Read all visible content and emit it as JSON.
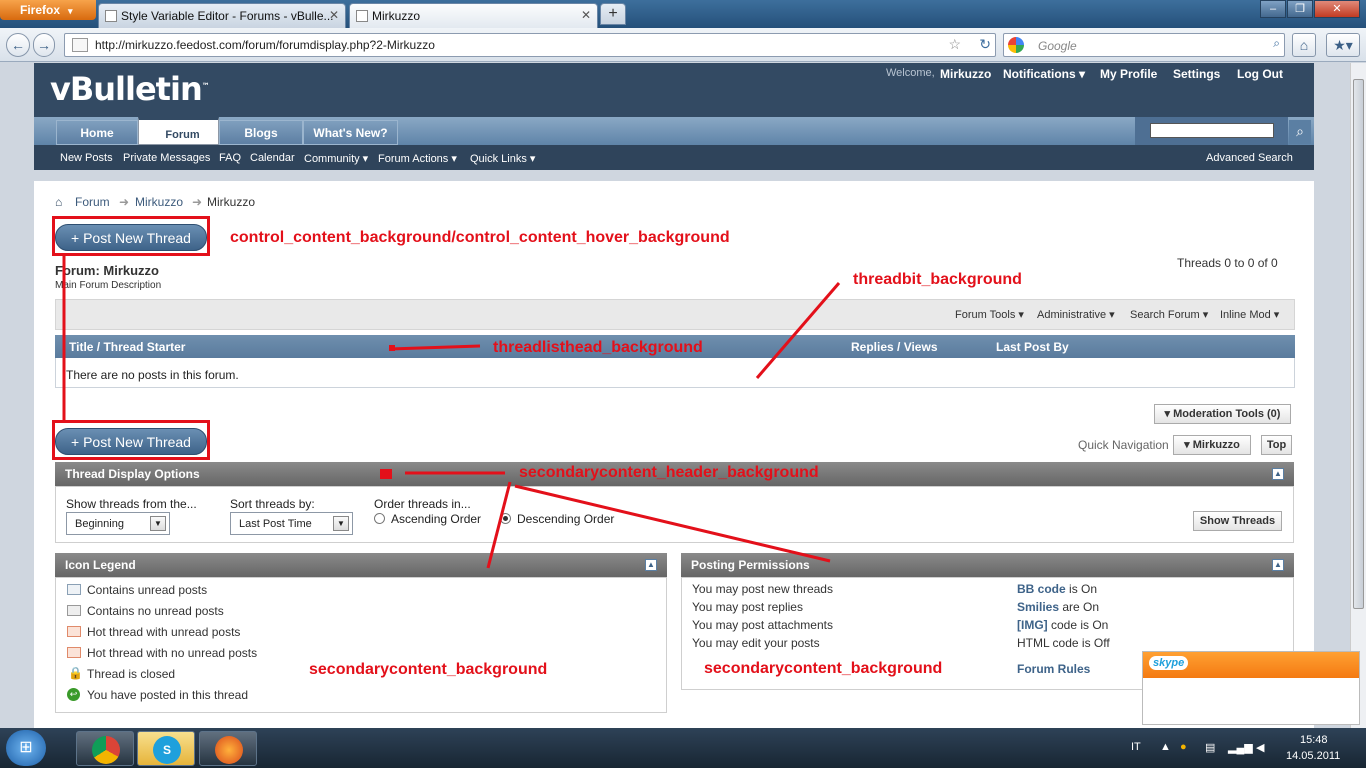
{
  "browser": {
    "app_button": "Firefox",
    "tabs": [
      {
        "label": "Style Variable Editor - Forums - vBulle..."
      },
      {
        "label": "Mirkuzzo"
      }
    ],
    "url": "http://mirkuzzo.feedost.com/forum/forumdisplay.php?2-Mirkuzzo",
    "search_placeholder": "Google"
  },
  "header": {
    "logo": "vBulletin",
    "welcome": "Welcome,",
    "username": "Mirkuzzo",
    "links": [
      "Notifications ▾",
      "My Profile",
      "Settings",
      "Log Out"
    ]
  },
  "nav": {
    "tabs": [
      "Home",
      "Forum",
      "Blogs",
      "What's New?"
    ],
    "subnav": [
      "New Posts",
      "Private Messages",
      "FAQ",
      "Calendar",
      "Community ▾",
      "Forum Actions ▾",
      "Quick Links ▾"
    ],
    "advanced_search": "Advanced Search"
  },
  "breadcrumb": [
    "Forum",
    "Mirkuzzo",
    "Mirkuzzo"
  ],
  "forum": {
    "post_button": "+ Post New Thread",
    "title": "Forum: Mirkuzzo",
    "description": "Main Forum Description",
    "threads_count": "Threads 0 to 0 of 0",
    "tools": [
      "Forum Tools ▾",
      "Administrative ▾",
      "Search Forum ▾",
      "Inline Mod ▾"
    ],
    "columns": {
      "title": "Title / Thread Starter",
      "replies": "Replies / Views",
      "last_post": "Last Post By"
    },
    "empty": "There are no posts in this forum.",
    "moderation": "▾ Moderation Tools (0)",
    "quick_nav_label": "Quick Navigation",
    "quick_nav_value": "▾ Mirkuzzo",
    "top": "Top"
  },
  "display_options": {
    "header": "Thread Display Options",
    "show_from_label": "Show threads from the...",
    "show_from_value": "Beginning",
    "sort_label": "Sort threads by:",
    "sort_value": "Last Post Time",
    "order_label": "Order threads in...",
    "asc": "Ascending Order",
    "desc": "Descending Order",
    "button": "Show Threads"
  },
  "legend": {
    "header": "Icon Legend",
    "items": [
      "Contains unread posts",
      "Contains no unread posts",
      "Hot thread with unread posts",
      "Hot thread with no unread posts",
      "Thread is closed",
      "You have posted in this thread"
    ]
  },
  "permissions": {
    "header": "Posting Permissions",
    "left": [
      "You may post new threads",
      "You may post replies",
      "You may post attachments",
      "You may edit your posts"
    ],
    "right": [
      {
        "b": "BB code",
        "t": " is On"
      },
      {
        "b": "Smilies",
        "t": " are On"
      },
      {
        "b": "[IMG]",
        "t": " code is On"
      },
      {
        "b": "",
        "t": "HTML code is Off"
      }
    ],
    "rules": "Forum Rules"
  },
  "annotations": {
    "a1": "control_content_background/control_content_hover_background",
    "a2": "threadbit_background",
    "a3": "threadlisthead_background",
    "a4": "secondarycontent_header_background",
    "a5": "secondarycontent_background",
    "a6": "secondarycontent_background"
  },
  "skype": {
    "logo": "skype"
  },
  "taskbar": {
    "lang": "IT",
    "time": "15:48",
    "date": "14.05.2011"
  },
  "colors": {
    "accent_red": "#e3101a",
    "header": "#334a63",
    "tabbar": "#6f8fae"
  }
}
